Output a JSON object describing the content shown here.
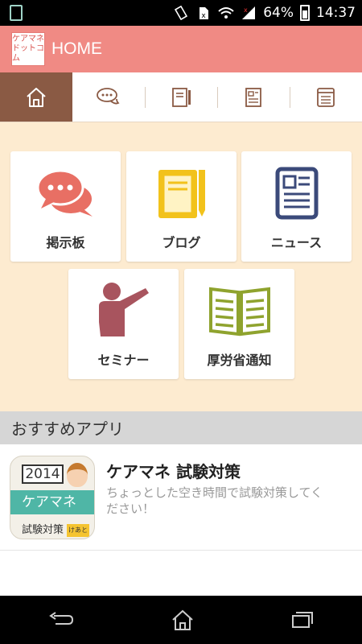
{
  "status_bar": {
    "battery": "64%",
    "time": "14:37"
  },
  "app_bar": {
    "logo_line1": "ケアマネ",
    "logo_line2": "ドットコム",
    "title": "HOME"
  },
  "tabs": [
    {
      "icon": "home-icon",
      "active": true
    },
    {
      "icon": "chat-bubbles-icon",
      "active": false
    },
    {
      "icon": "notebook-icon",
      "active": false
    },
    {
      "icon": "newspaper-icon",
      "active": false
    },
    {
      "icon": "browser-list-icon",
      "active": false
    }
  ],
  "tiles": [
    {
      "label": "掲示板",
      "icon": "speech-bubbles-icon",
      "color": "#e86f64"
    },
    {
      "label": "ブログ",
      "icon": "notebook-pencil-icon",
      "color": "#f2c21b"
    },
    {
      "label": "ニュース",
      "icon": "news-document-icon",
      "color": "#3b4a7a"
    },
    {
      "label": "セミナー",
      "icon": "presenter-icon",
      "color": "#a8545e"
    },
    {
      "label": "厚労省通知",
      "icon": "open-book-icon",
      "color": "#8fa32e"
    }
  ],
  "recommend": {
    "header": "おすすめアプリ",
    "app": {
      "title": "ケアマネ 試験対策",
      "description": "ちょっとした空き時間で試験対策してください！",
      "icon_year": "2014",
      "icon_band": "ケアマネ",
      "icon_sub": "試験対策",
      "icon_tag": "けあとも"
    }
  },
  "colors": {
    "accent": "#f08a84",
    "tab_active": "#8a5a44",
    "background": "#fdebd0"
  }
}
